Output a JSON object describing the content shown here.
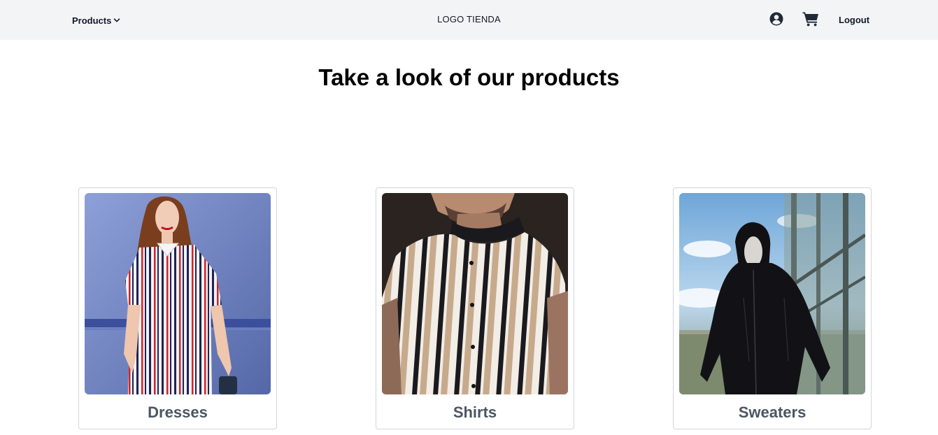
{
  "navbar": {
    "products_label": "Products",
    "logo_text": "LOGO TIENDA",
    "logout_label": "Logout",
    "icons": [
      "chevron-down-icon",
      "user-circle-icon",
      "shopping-cart-icon"
    ]
  },
  "main": {
    "title": "Take a look of our products",
    "categories": [
      {
        "label": "Dresses",
        "image": "striped-dress-photo"
      },
      {
        "label": "Shirts",
        "image": "striped-shirt-photo"
      },
      {
        "label": "Sweaters",
        "image": "black-hoodie-photo"
      }
    ]
  },
  "colors": {
    "navbar_bg": "#f3f4f6",
    "text_dark": "#111827",
    "card_label": "#4b5563",
    "card_border": "#d1d5db"
  }
}
